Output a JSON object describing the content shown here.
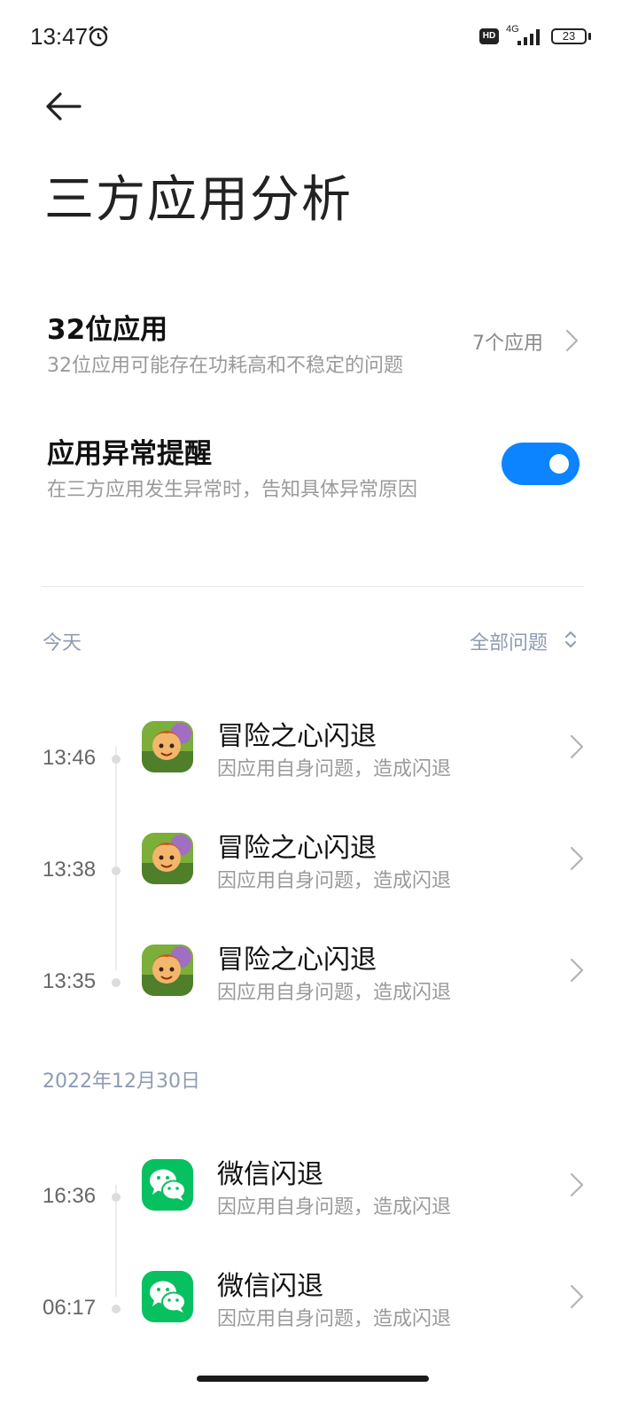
{
  "status": {
    "time": "13:47",
    "hd_label": "HD",
    "network": "4G",
    "battery": "23",
    "alarm_icon": "alarm-icon",
    "signal_icon": "signal-icon"
  },
  "header": {
    "back_icon": "back-arrow-icon",
    "title": "三方应用分析"
  },
  "settings": {
    "apps32": {
      "title": "32位应用",
      "subtitle": "32位应用可能存在功耗高和不稳定的问题",
      "value": "7个应用"
    },
    "anomaly": {
      "title": "应用异常提醒",
      "subtitle": "在三方应用发生异常时，告知具体异常原因",
      "enabled": true
    }
  },
  "filter": {
    "label": "全部问题",
    "icon": "sort-updown-icon"
  },
  "sections": [
    {
      "date": "今天",
      "items": [
        {
          "time": "13:46",
          "title": "冒险之心闪退",
          "subtitle": "因应用自身问题，造成闪退",
          "icon": "game-icon"
        },
        {
          "time": "13:38",
          "title": "冒险之心闪退",
          "subtitle": "因应用自身问题，造成闪退",
          "icon": "game-icon"
        },
        {
          "time": "13:35",
          "title": "冒险之心闪退",
          "subtitle": "因应用自身问题，造成闪退",
          "icon": "game-icon"
        }
      ]
    },
    {
      "date": "2022年12月30日",
      "items": [
        {
          "time": "16:36",
          "title": "微信闪退",
          "subtitle": "因应用自身问题，造成闪退",
          "icon": "wechat-icon"
        },
        {
          "time": "06:17",
          "title": "微信闪退",
          "subtitle": "因应用自身问题，造成闪退",
          "icon": "wechat-icon"
        }
      ]
    }
  ],
  "colors": {
    "accent": "#0d84ff",
    "wechat_green": "#07c160",
    "section_label": "#8e9bb3"
  }
}
